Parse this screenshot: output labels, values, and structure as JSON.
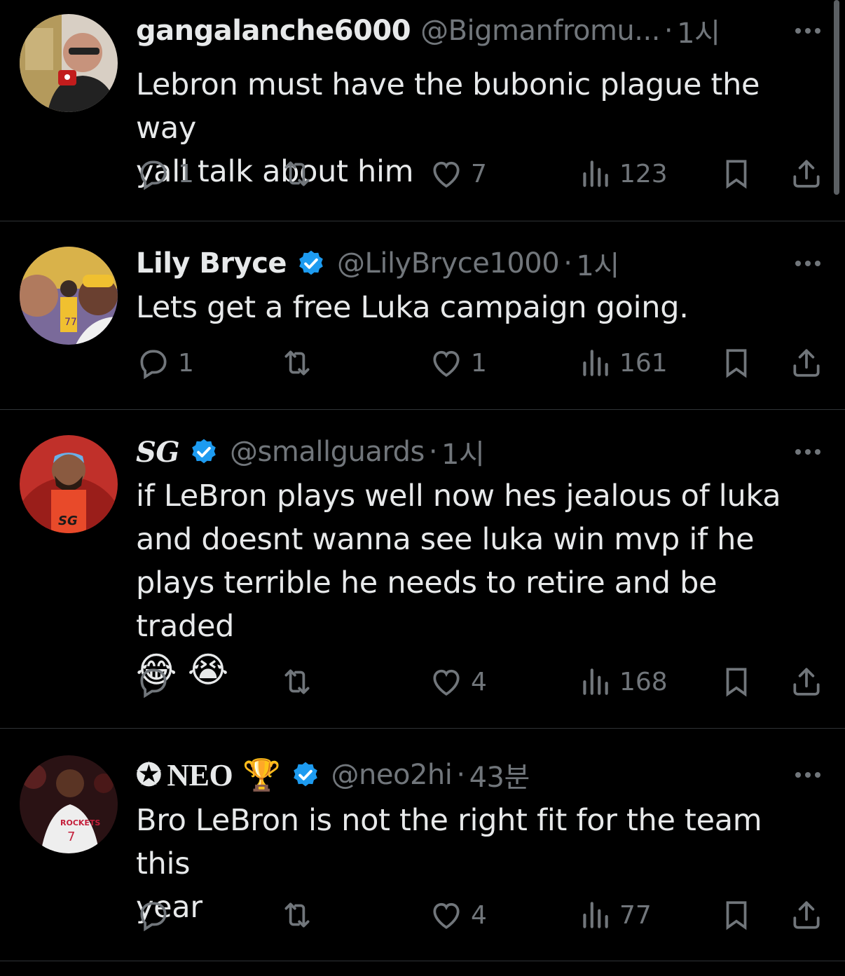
{
  "tweets": [
    {
      "name": "gangalanche6000",
      "handle": "@Bigmanfromu...",
      "time": "1시",
      "verified": false,
      "text_lines": [
        "Lebron must have the bubonic plague the way",
        "yall talk about him"
      ],
      "replies": "1",
      "retweets": "",
      "likes": "7",
      "views": "123"
    },
    {
      "name": "Lily Bryce",
      "handle": "@LilyBryce1000",
      "time": "1시",
      "verified": true,
      "text_lines": [
        "Lets get a free Luka campaign going."
      ],
      "replies": "1",
      "retweets": "",
      "likes": "1",
      "views": "161"
    },
    {
      "name": "SG",
      "handle": "@smallguards",
      "time": "1시",
      "verified": true,
      "text_lines": [
        "if LeBron plays well now hes jealous of luka",
        "and doesnt wanna see luka win mvp if he",
        "plays terrible he needs to retire and be traded"
      ],
      "emojis": "😂 😭",
      "replies": "",
      "retweets": "",
      "likes": "4",
      "views": "168"
    },
    {
      "name_prefix": "✪",
      "name": "NEO",
      "name_suffix": "🏆",
      "handle": "@neo2hi",
      "time": "43분",
      "verified": true,
      "text_lines": [
        "Bro LeBron is not the right fit for the team this",
        "year"
      ],
      "replies": "",
      "retweets": "",
      "likes": "4",
      "views": "77"
    }
  ],
  "separator": "·",
  "colors": {
    "background": "#000000",
    "text": "#e7e9ea",
    "muted": "#71767b",
    "verified": "#1d9bf0",
    "border": "#2f3336"
  },
  "icons": [
    "reply-icon",
    "retweet-icon",
    "like-icon",
    "views-icon",
    "bookmark-icon",
    "share-icon",
    "more-icon",
    "verified-badge-icon"
  ]
}
